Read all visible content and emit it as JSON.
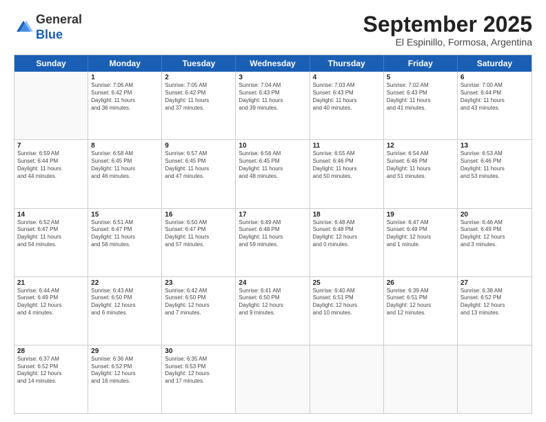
{
  "logo": {
    "general": "General",
    "blue": "Blue"
  },
  "title": "September 2025",
  "subtitle": "El Espinillo, Formosa, Argentina",
  "days": [
    "Sunday",
    "Monday",
    "Tuesday",
    "Wednesday",
    "Thursday",
    "Friday",
    "Saturday"
  ],
  "weeks": [
    [
      {
        "day": "",
        "lines": []
      },
      {
        "day": "1",
        "lines": [
          "Sunrise: 7:06 AM",
          "Sunset: 6:42 PM",
          "Daylight: 11 hours",
          "and 36 minutes."
        ]
      },
      {
        "day": "2",
        "lines": [
          "Sunrise: 7:05 AM",
          "Sunset: 6:42 PM",
          "Daylight: 11 hours",
          "and 37 minutes."
        ]
      },
      {
        "day": "3",
        "lines": [
          "Sunrise: 7:04 AM",
          "Sunset: 6:43 PM",
          "Daylight: 11 hours",
          "and 39 minutes."
        ]
      },
      {
        "day": "4",
        "lines": [
          "Sunrise: 7:03 AM",
          "Sunset: 6:43 PM",
          "Daylight: 11 hours",
          "and 40 minutes."
        ]
      },
      {
        "day": "5",
        "lines": [
          "Sunrise: 7:02 AM",
          "Sunset: 6:43 PM",
          "Daylight: 11 hours",
          "and 41 minutes."
        ]
      },
      {
        "day": "6",
        "lines": [
          "Sunrise: 7:00 AM",
          "Sunset: 6:44 PM",
          "Daylight: 11 hours",
          "and 43 minutes."
        ]
      }
    ],
    [
      {
        "day": "7",
        "lines": [
          "Sunrise: 6:59 AM",
          "Sunset: 6:44 PM",
          "Daylight: 11 hours",
          "and 44 minutes."
        ]
      },
      {
        "day": "8",
        "lines": [
          "Sunrise: 6:58 AM",
          "Sunset: 6:45 PM",
          "Daylight: 11 hours",
          "and 46 minutes."
        ]
      },
      {
        "day": "9",
        "lines": [
          "Sunrise: 6:57 AM",
          "Sunset: 6:45 PM",
          "Daylight: 11 hours",
          "and 47 minutes."
        ]
      },
      {
        "day": "10",
        "lines": [
          "Sunrise: 6:56 AM",
          "Sunset: 6:45 PM",
          "Daylight: 11 hours",
          "and 48 minutes."
        ]
      },
      {
        "day": "11",
        "lines": [
          "Sunrise: 6:55 AM",
          "Sunset: 6:46 PM",
          "Daylight: 11 hours",
          "and 50 minutes."
        ]
      },
      {
        "day": "12",
        "lines": [
          "Sunrise: 6:54 AM",
          "Sunset: 6:46 PM",
          "Daylight: 11 hours",
          "and 51 minutes."
        ]
      },
      {
        "day": "13",
        "lines": [
          "Sunrise: 6:53 AM",
          "Sunset: 6:46 PM",
          "Daylight: 11 hours",
          "and 53 minutes."
        ]
      }
    ],
    [
      {
        "day": "14",
        "lines": [
          "Sunrise: 6:52 AM",
          "Sunset: 6:47 PM",
          "Daylight: 11 hours",
          "and 54 minutes."
        ]
      },
      {
        "day": "15",
        "lines": [
          "Sunrise: 6:51 AM",
          "Sunset: 6:47 PM",
          "Daylight: 11 hours",
          "and 56 minutes."
        ]
      },
      {
        "day": "16",
        "lines": [
          "Sunrise: 6:50 AM",
          "Sunset: 6:47 PM",
          "Daylight: 11 hours",
          "and 57 minutes."
        ]
      },
      {
        "day": "17",
        "lines": [
          "Sunrise: 6:49 AM",
          "Sunset: 6:48 PM",
          "Daylight: 11 hours",
          "and 59 minutes."
        ]
      },
      {
        "day": "18",
        "lines": [
          "Sunrise: 6:48 AM",
          "Sunset: 6:48 PM",
          "Daylight: 12 hours",
          "and 0 minutes."
        ]
      },
      {
        "day": "19",
        "lines": [
          "Sunrise: 6:47 AM",
          "Sunset: 6:49 PM",
          "Daylight: 12 hours",
          "and 1 minute."
        ]
      },
      {
        "day": "20",
        "lines": [
          "Sunrise: 6:46 AM",
          "Sunset: 6:49 PM",
          "Daylight: 12 hours",
          "and 3 minutes."
        ]
      }
    ],
    [
      {
        "day": "21",
        "lines": [
          "Sunrise: 6:44 AM",
          "Sunset: 6:49 PM",
          "Daylight: 12 hours",
          "and 4 minutes."
        ]
      },
      {
        "day": "22",
        "lines": [
          "Sunrise: 6:43 AM",
          "Sunset: 6:50 PM",
          "Daylight: 12 hours",
          "and 6 minutes."
        ]
      },
      {
        "day": "23",
        "lines": [
          "Sunrise: 6:42 AM",
          "Sunset: 6:50 PM",
          "Daylight: 12 hours",
          "and 7 minutes."
        ]
      },
      {
        "day": "24",
        "lines": [
          "Sunrise: 6:41 AM",
          "Sunset: 6:50 PM",
          "Daylight: 12 hours",
          "and 9 minutes."
        ]
      },
      {
        "day": "25",
        "lines": [
          "Sunrise: 6:40 AM",
          "Sunset: 6:51 PM",
          "Daylight: 12 hours",
          "and 10 minutes."
        ]
      },
      {
        "day": "26",
        "lines": [
          "Sunrise: 6:39 AM",
          "Sunset: 6:51 PM",
          "Daylight: 12 hours",
          "and 12 minutes."
        ]
      },
      {
        "day": "27",
        "lines": [
          "Sunrise: 6:38 AM",
          "Sunset: 6:52 PM",
          "Daylight: 12 hours",
          "and 13 minutes."
        ]
      }
    ],
    [
      {
        "day": "28",
        "lines": [
          "Sunrise: 6:37 AM",
          "Sunset: 6:52 PM",
          "Daylight: 12 hours",
          "and 14 minutes."
        ]
      },
      {
        "day": "29",
        "lines": [
          "Sunrise: 6:36 AM",
          "Sunset: 6:52 PM",
          "Daylight: 12 hours",
          "and 16 minutes."
        ]
      },
      {
        "day": "30",
        "lines": [
          "Sunrise: 6:35 AM",
          "Sunset: 6:53 PM",
          "Daylight: 12 hours",
          "and 17 minutes."
        ]
      },
      {
        "day": "",
        "lines": []
      },
      {
        "day": "",
        "lines": []
      },
      {
        "day": "",
        "lines": []
      },
      {
        "day": "",
        "lines": []
      }
    ]
  ]
}
